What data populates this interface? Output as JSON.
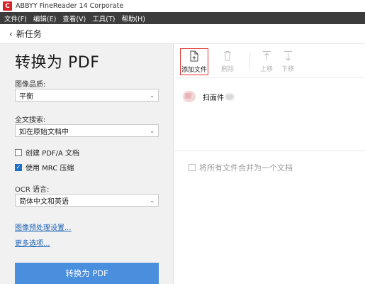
{
  "window": {
    "title": "ABBYY FineReader 14 Corporate",
    "logo_letter": "C"
  },
  "menu": [
    "文件(F)",
    "编辑(E)",
    "查看(V)",
    "工具(T)",
    "帮助(H)"
  ],
  "back": {
    "chevron": "‹",
    "label": "新任务"
  },
  "page_title": "转换为 PDF",
  "image_quality": {
    "label": "图像品质:",
    "value": "平衡"
  },
  "fulltext_search": {
    "label": "全文搜索:",
    "value": "如在原始文档中"
  },
  "create_pdfa": {
    "label": "创建 PDF/A 文档",
    "checked": false
  },
  "use_mrc": {
    "label": "使用 MRC 压缩",
    "checked": true
  },
  "ocr_language": {
    "label": "OCR 语言:",
    "value": "简体中文和英语"
  },
  "links": {
    "preprocess": "图像预处理设置...",
    "more_options": "更多选项..."
  },
  "convert_button": "转换为 PDF",
  "toolbar": {
    "add_file": "添加文件",
    "delete": "删除",
    "move_up": "上移",
    "move_down": "下移"
  },
  "file_list": [
    {
      "name": "扫面件"
    }
  ],
  "merge_option": {
    "label": "将所有文件合并为一个文档",
    "checked": false
  },
  "colors": {
    "menubar": "#3c3c3c",
    "accent": "#4a8ede",
    "highlight": "#e0302a",
    "link": "#1f63b8"
  },
  "icons": [
    "app-logo-icon",
    "back-chevron-icon",
    "dropdown-chevron-icon",
    "add-file-icon",
    "delete-icon",
    "move-up-icon",
    "move-down-icon",
    "file-thumbnail-icon"
  ]
}
